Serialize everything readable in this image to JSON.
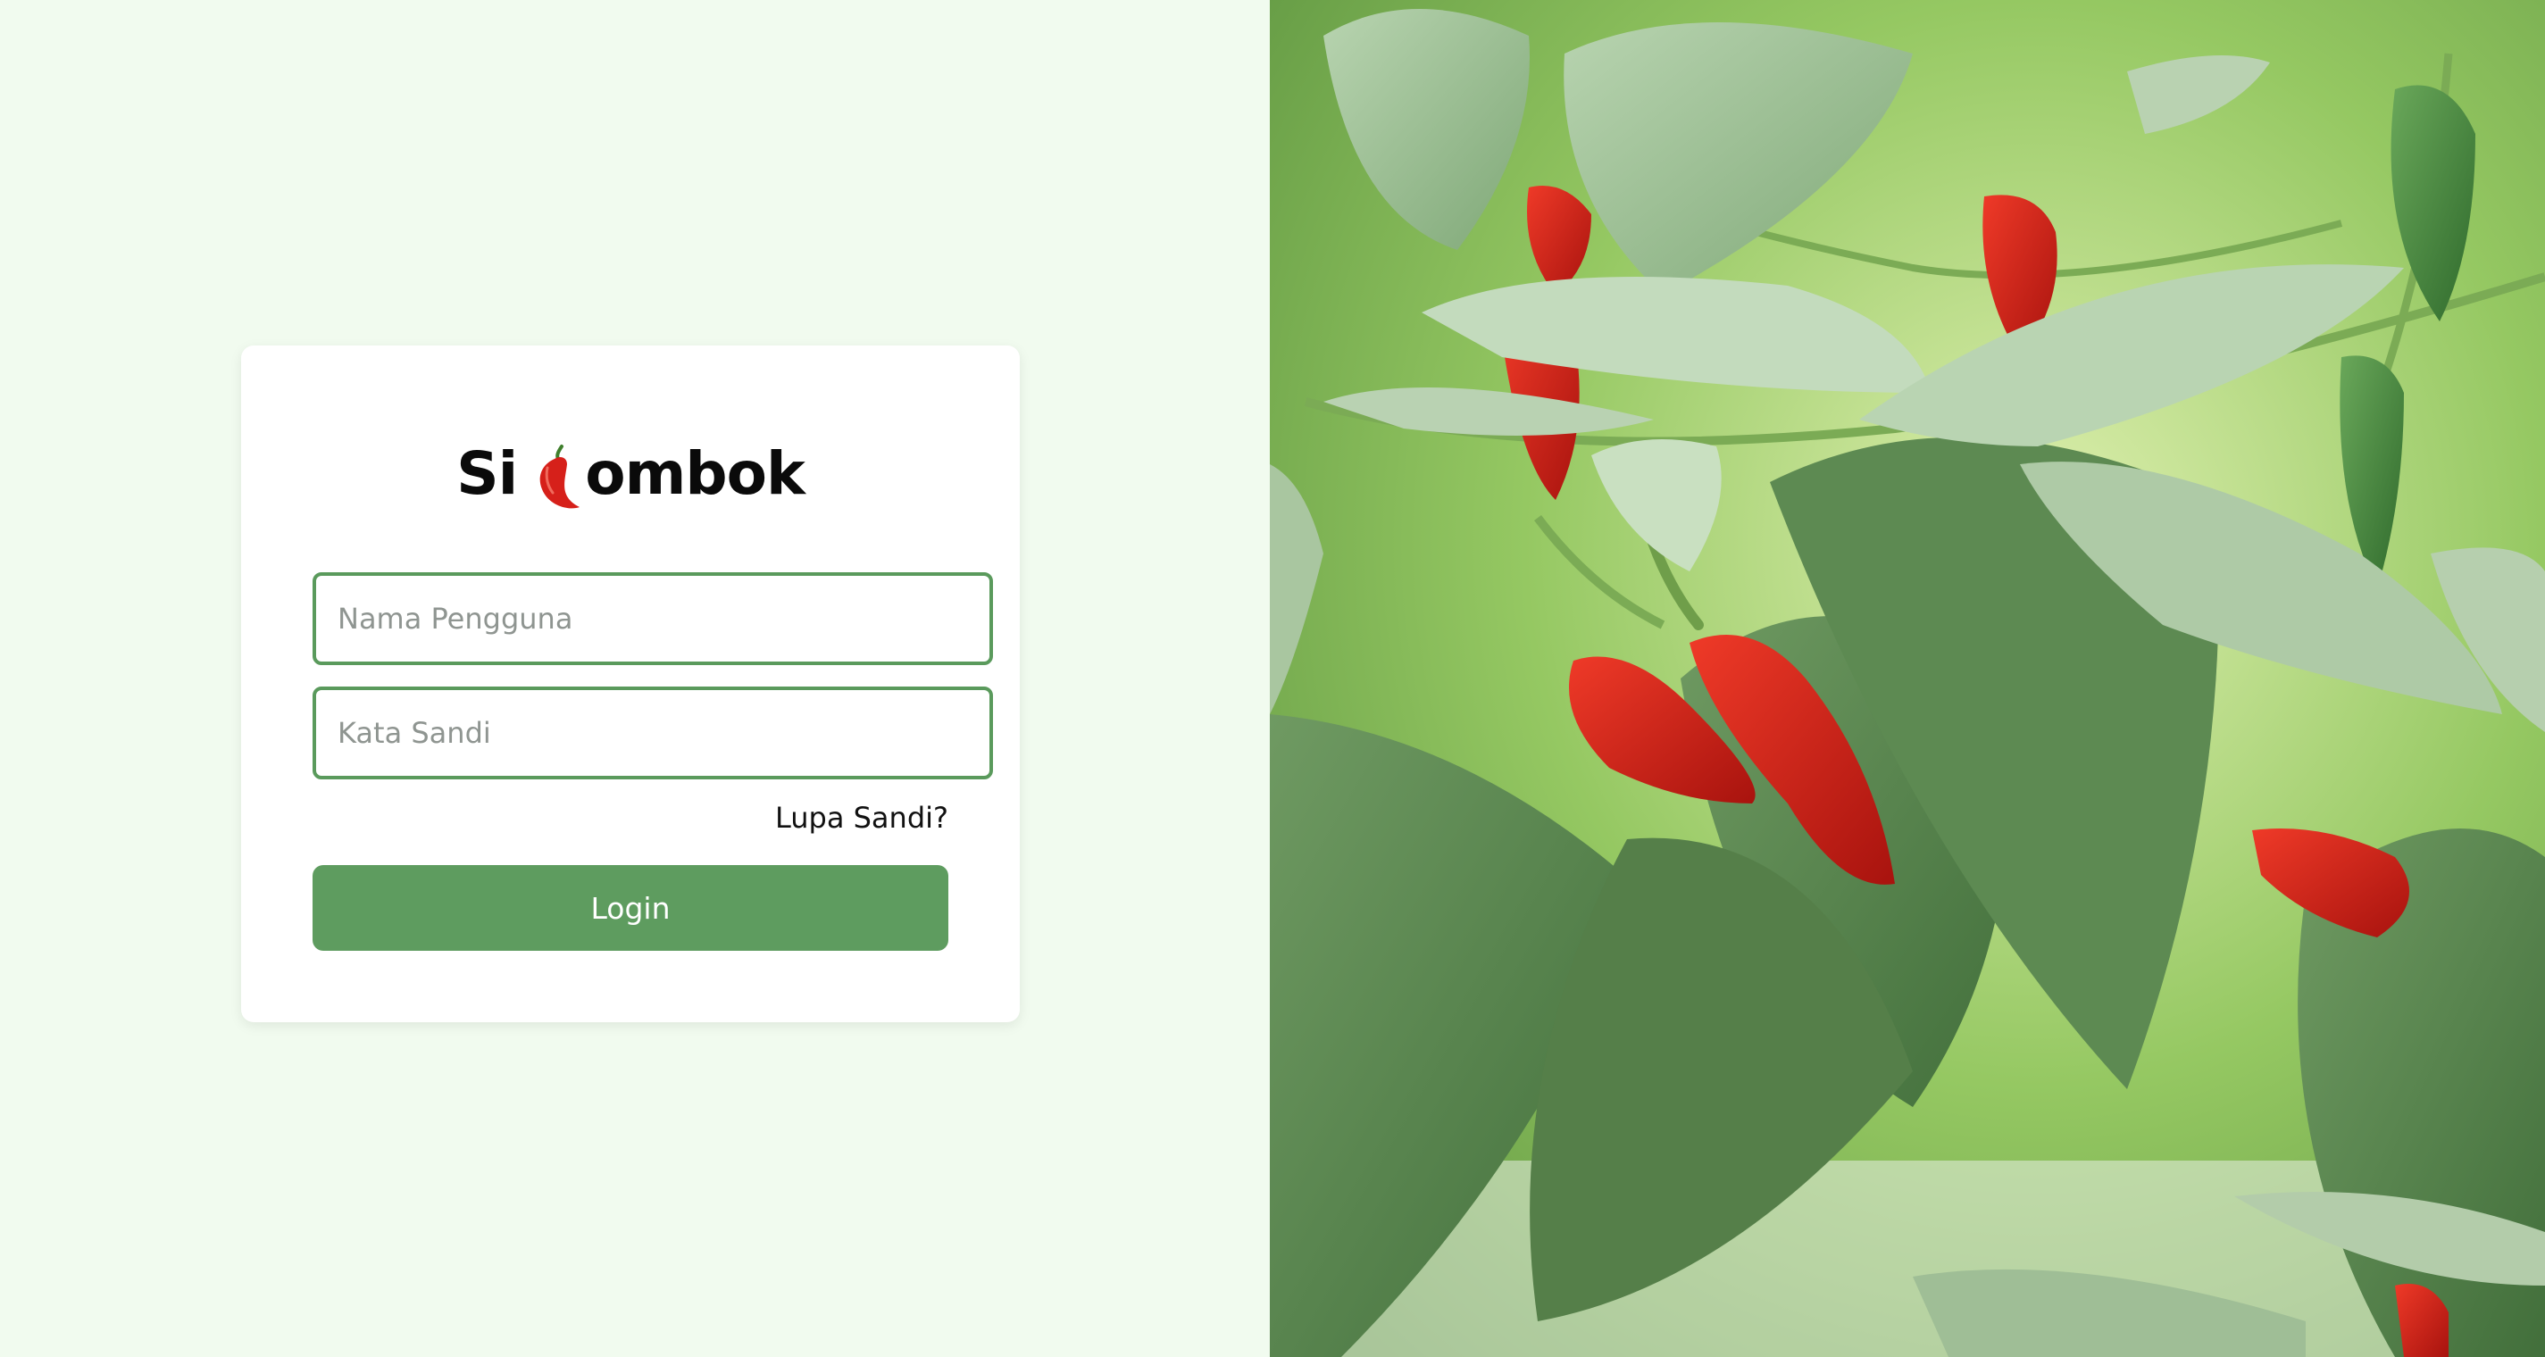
{
  "brand": {
    "prefix": "Si",
    "suffix": "ombok",
    "logo_icon": "chili-pepper-icon"
  },
  "form": {
    "username_placeholder": "Nama Pengguna",
    "password_placeholder": "Kata Sandi",
    "forgot_label": "Lupa Sandi?",
    "login_label": "Login"
  },
  "colors": {
    "page_bg": "#f1fbef",
    "accent": "#5e9c5f",
    "field_border": "#5a9a5c",
    "chili_red": "#d6201a",
    "leaf_green": "#6aa04a"
  },
  "hero": {
    "image_icon": "chili-plant-photo"
  }
}
